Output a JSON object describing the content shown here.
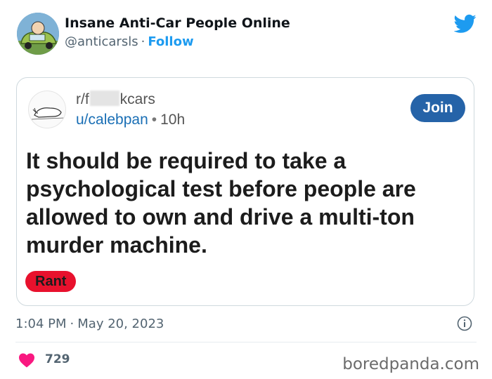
{
  "tweet": {
    "display_name": "Insane Anti-Car People Online",
    "handle": "@anticarsls",
    "separator": "·",
    "follow_label": "Follow",
    "timestamp_time": "1:04 PM",
    "timestamp_date": "May 20, 2023",
    "like_count": "729"
  },
  "reddit_post": {
    "subreddit_prefix": "r/f",
    "subreddit_suffix": "kcars",
    "username": "u/calebpan",
    "meta_separator": "•",
    "age": "10h",
    "join_label": "Join",
    "title": "It should be required to take a psychological test before people are allowed to own and drive a multi-ton murder machine.",
    "flair": "Rant"
  },
  "watermark": "boredpanda.com",
  "icons": {
    "avatar": "car-cartoon-avatar",
    "subreddit_avatar": "cat-sketch-icon",
    "bird": "twitter-bird-icon",
    "info": "info-icon",
    "like": "heart-icon"
  },
  "colors": {
    "twitter_blue": "#1d9bf0",
    "join_button": "#2563a8",
    "flair": "#e8112d",
    "heart": "#f91880"
  }
}
